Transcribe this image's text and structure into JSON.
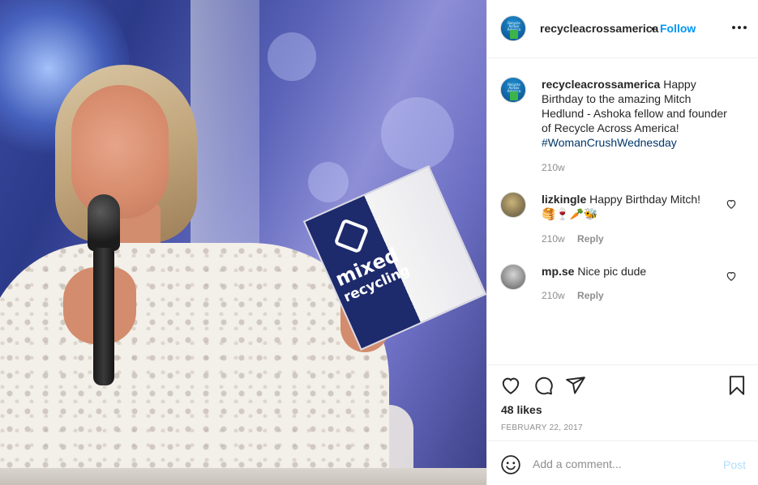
{
  "post": {
    "image_alt": "Woman speaking into a microphone holding a mixed recycling brochure",
    "brochure": {
      "headline": "mixed",
      "subline": "recycling"
    }
  },
  "header": {
    "avatar_text": "Recycle Across America",
    "username": "recycleacrossamerica",
    "separator": "•",
    "follow_label": "Follow",
    "more_icon": "more-horizontal-icon"
  },
  "caption": {
    "username": "recycleacrossamerica",
    "text": "Happy Birthday to the amazing Mitch Hedlund - Ashoka fellow and founder of Recycle Across America!",
    "hashtag": "#WomanCrushWednesday",
    "time": "210w"
  },
  "comments": [
    {
      "username": "lizkingle",
      "text": "Happy Birthday Mitch!",
      "emoji": "🥞🍷🥕🐝",
      "time": "210w",
      "reply_label": "Reply"
    },
    {
      "username": "mp.se",
      "text": "Nice pic dude",
      "time": "210w",
      "reply_label": "Reply"
    }
  ],
  "actions": {
    "icons": [
      "heart-icon",
      "comment-icon",
      "share-icon",
      "bookmark-icon"
    ],
    "likes": "48 likes",
    "date": "FEBRUARY 22, 2017"
  },
  "add_comment": {
    "placeholder": "Add a comment...",
    "post_label": "Post"
  },
  "colors": {
    "link_blue": "#0095f6",
    "post_disabled": "#b2dffc",
    "hashtag": "#00376b",
    "muted": "#8e8e8e"
  }
}
